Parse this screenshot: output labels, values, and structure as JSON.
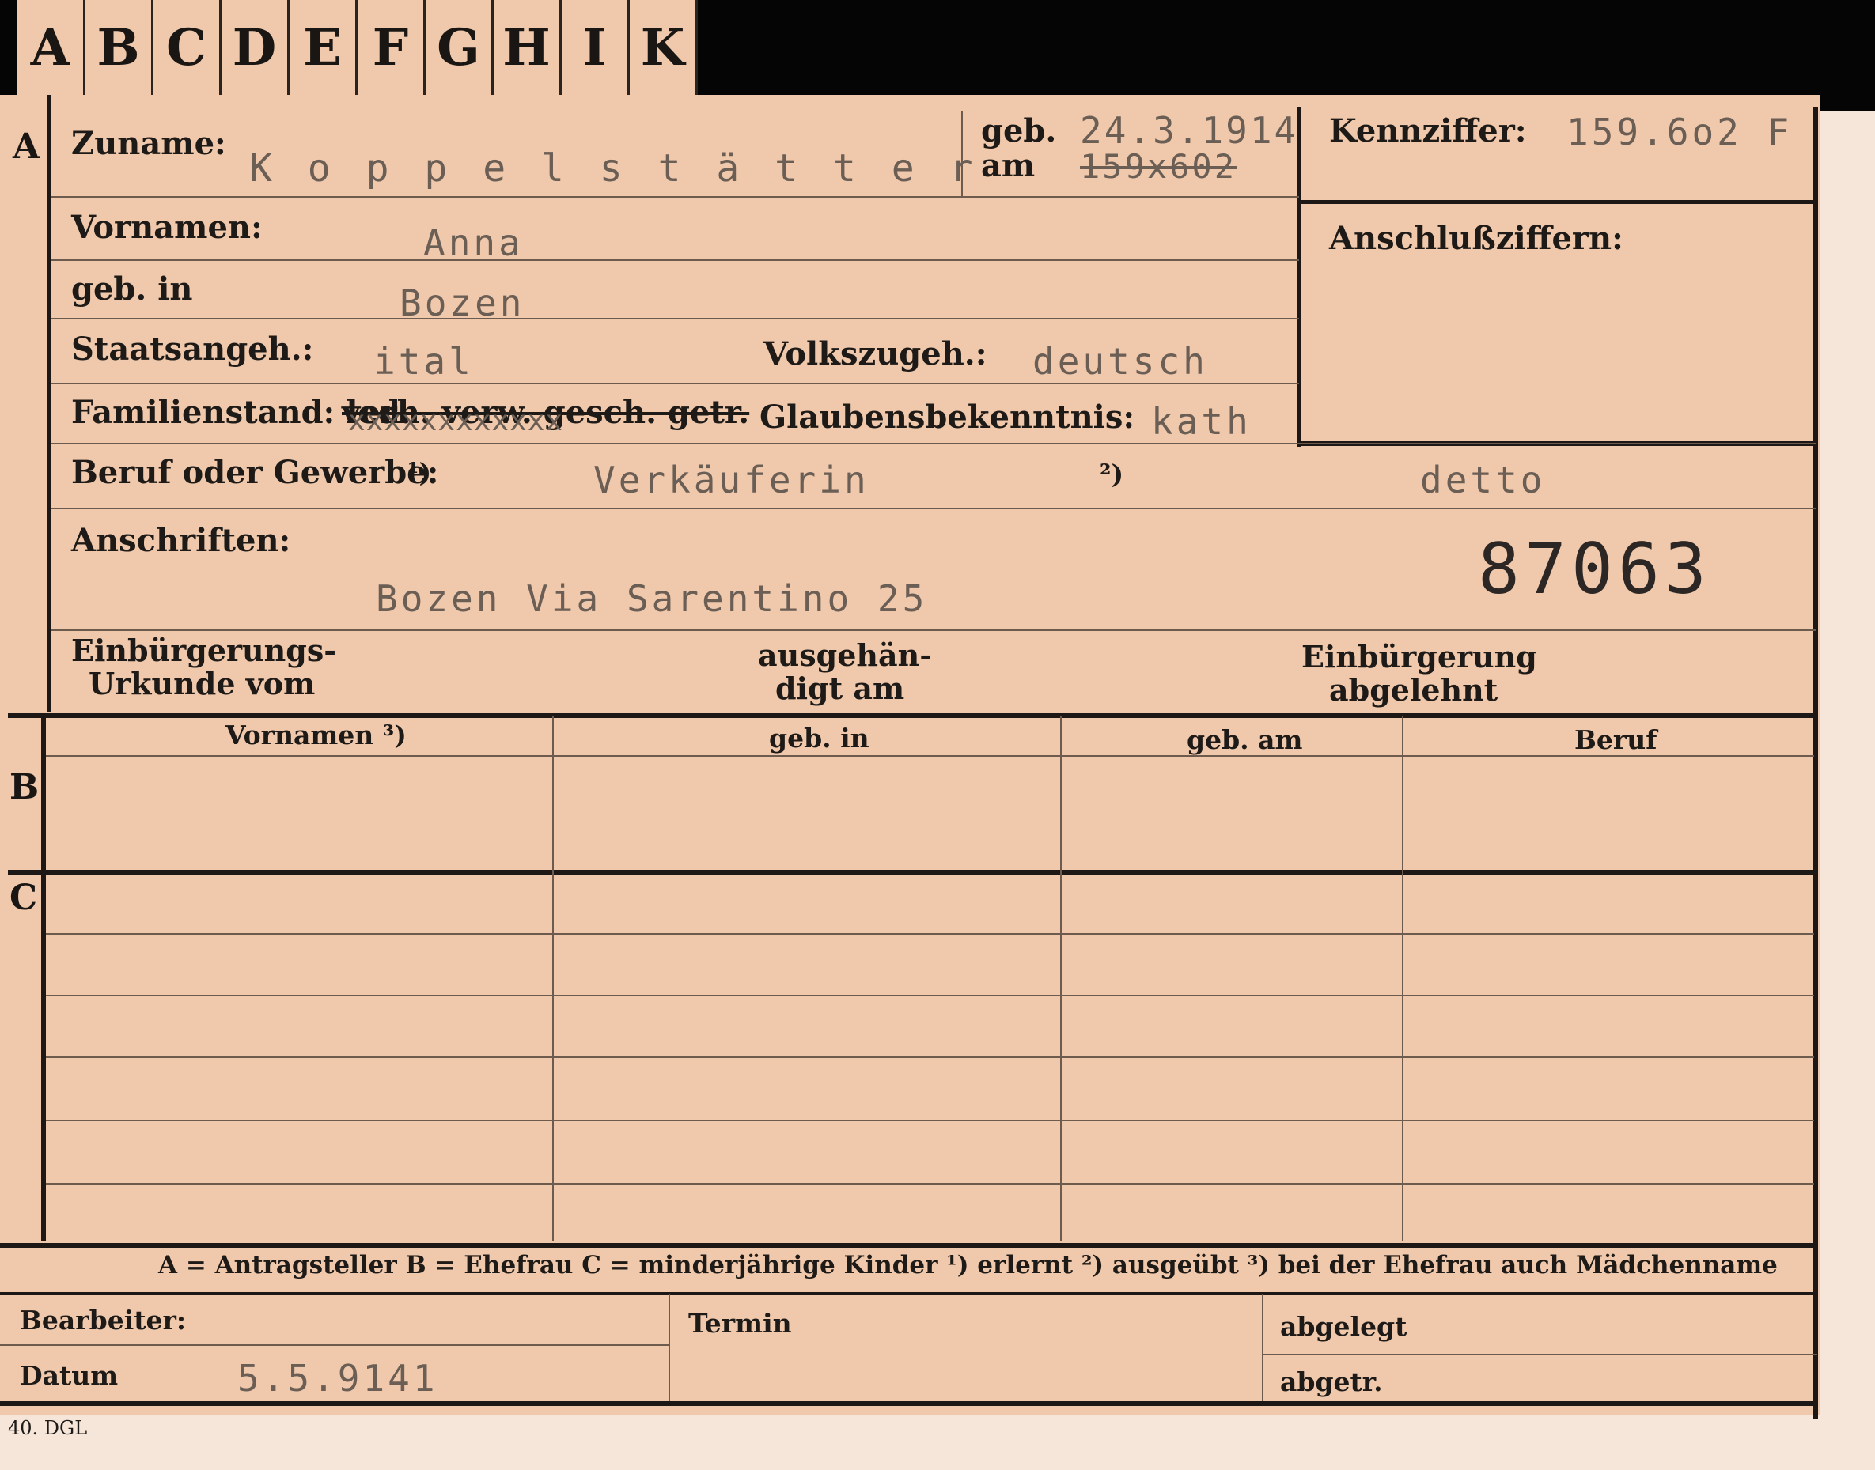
{
  "tabs": [
    "A",
    "B",
    "C",
    "D",
    "E",
    "F",
    "G",
    "H",
    "I",
    "K"
  ],
  "sections": {
    "a": "A",
    "b": "B",
    "c": "C"
  },
  "fields": {
    "zuname_label": "Zuname:",
    "zuname_value": "K o p p e l s t ä t t e r",
    "geb_label": "geb.",
    "am_label": "am",
    "geb_date": "24.3.1914",
    "geb_struck": "159x602",
    "kennziffer_label": "Kennziffer:",
    "kennziffer_value": "159.6o2 F",
    "anschluss_label": "Anschlußziffern:",
    "vornamen_label": "Vornamen:",
    "vornamen_value": "Anna",
    "gebin_label": "geb. in",
    "gebin_value": "Bozen",
    "staat_label": "Staatsangeh.:",
    "staat_value": "ital",
    "volk_label": "Volkszugeh.:",
    "volk_value": "deutsch",
    "familie_label": "Familienstand: led.",
    "familie_struck": "verh. verw. gesch. getr.",
    "familie_xs": "xxxxxxxxxxxx",
    "glaube_label": "Glaubensbekenntnis:",
    "glaube_value": "kath",
    "beruf_label": "Beruf oder Gewerbe:",
    "beruf_note1": "¹)",
    "beruf_value1": "Verkäuferin",
    "beruf_note2": "²)",
    "beruf_value2": "detto",
    "anschrift_label": "Anschriften:",
    "anschrift_value": "Bozen Via Sarentino 25",
    "number": "87063",
    "einb1_l1": "Einbürgerungs-",
    "einb1_l2": "Urkunde vom",
    "ausg_l1": "ausgehän-",
    "ausg_l2": "digt am",
    "einb2_l1": "Einbürgerung",
    "einb2_l2": "abgelehnt"
  },
  "table": {
    "headers": [
      "Vornamen ³)",
      "geb. in",
      "geb. am",
      "Beruf"
    ]
  },
  "legend": "A = Antragsteller   B = Ehefrau   C = minderjährige Kinder   ¹) erlernt   ²) ausgeübt   ³) bei der Ehefrau auch Mädchenname",
  "footer": {
    "bearbeiter": "Bearbeiter:",
    "datum": "Datum",
    "datum_value": "5.5.9141",
    "termin": "Termin",
    "abgelegt": "abgelegt",
    "abgetr": "abgetr.",
    "print_code": "40. DGL"
  }
}
